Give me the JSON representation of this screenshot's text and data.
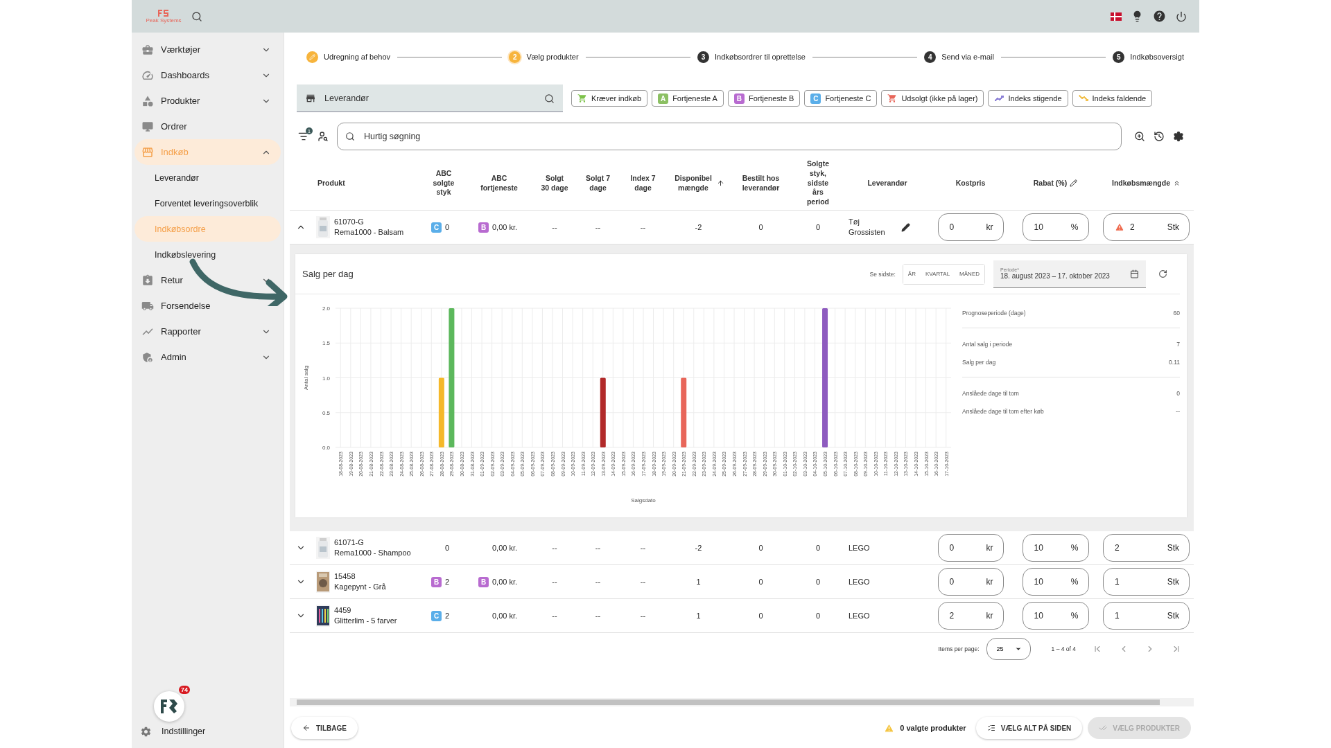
{
  "topbar": {
    "logo_text": "Peak Systems"
  },
  "sidebar": {
    "items": [
      {
        "kind": "group",
        "label": "Værktøjer",
        "expanded": false,
        "selected": false
      },
      {
        "kind": "group",
        "label": "Dashboards",
        "expanded": false,
        "selected": false
      },
      {
        "kind": "group",
        "label": "Produkter",
        "expanded": false,
        "selected": false
      },
      {
        "kind": "link",
        "label": "Ordrer",
        "selected": false
      },
      {
        "kind": "group",
        "label": "Indkøb",
        "expanded": true,
        "selected": true,
        "children": [
          {
            "label": "Leverandør",
            "selected": false
          },
          {
            "label": "Forventet leveringsoverblik",
            "selected": false
          },
          {
            "label": "Indkøbsordre",
            "selected": true
          },
          {
            "label": "Indkøbslevering",
            "selected": false
          }
        ]
      },
      {
        "kind": "group",
        "label": "Retur",
        "expanded": false,
        "selected": false
      },
      {
        "kind": "link",
        "label": "Forsendelse",
        "selected": false
      },
      {
        "kind": "group",
        "label": "Rapporter",
        "expanded": false,
        "selected": false
      },
      {
        "kind": "group",
        "label": "Admin",
        "expanded": false,
        "selected": false
      }
    ],
    "notification_count": "74",
    "settings_label": "Indstillinger"
  },
  "stepper": [
    {
      "label": "Udregning af behov",
      "completed": true,
      "selected": false
    },
    {
      "number": "2",
      "label": "Vælg produkter",
      "completed": false,
      "selected": true
    },
    {
      "number": "3",
      "label": "Indkøbsordrer til oprettelse",
      "completed": false,
      "selected": false
    },
    {
      "number": "4",
      "label": "Send via e-mail",
      "completed": false,
      "selected": false
    },
    {
      "number": "5",
      "label": "Indkøbsoversigt",
      "completed": false,
      "selected": false
    }
  ],
  "supplier_field": {
    "placeholder": "Leverandør"
  },
  "filter_chips": [
    {
      "kind": "cart",
      "label": "Kræver indkøb",
      "color": "#7dc24a"
    },
    {
      "kind": "grade",
      "grade": "A",
      "label": "Fortjeneste A",
      "color": "#8cc063"
    },
    {
      "kind": "grade",
      "grade": "B",
      "label": "Fortjeneste B",
      "color": "#b86bd0"
    },
    {
      "kind": "grade",
      "grade": "C",
      "label": "Fortjeneste C",
      "color": "#5aaee9"
    },
    {
      "kind": "cart",
      "label": "Udsolgt (ikke på lager)",
      "color": "#e8665a"
    },
    {
      "kind": "trend-up",
      "label": "Indeks stigende",
      "color": "#8b7fd6"
    },
    {
      "kind": "trend-down",
      "label": "Indeks faldende",
      "color": "#f2c14e"
    }
  ],
  "filter_badge": "1",
  "quick_search": {
    "placeholder": "Hurtig søgning"
  },
  "table": {
    "columns": [
      {
        "label": "Produkt"
      },
      {
        "label": "ABC solgte styk"
      },
      {
        "label": "ABC fortjeneste"
      },
      {
        "label": "Solgt 30 dage"
      },
      {
        "label": "Solgt 7 dage"
      },
      {
        "label": "Index 7 dage"
      },
      {
        "label": "Disponibel mængde"
      },
      {
        "label": "Bestilt hos leverandør"
      },
      {
        "label": "Solgte styk, sidste års period"
      },
      {
        "label": "Leverandør"
      },
      {
        "label": "Kostpris"
      },
      {
        "label": "Rabat (%)"
      },
      {
        "label": "Indkøbsmængde"
      }
    ],
    "rows": [
      {
        "expanded": true,
        "sku": "61070-G",
        "name": "Rema1000 - Balsam",
        "abc_sold": {
          "grade": "C",
          "color": "#5aaee9",
          "value": "0"
        },
        "abc_profit": {
          "grade": "B",
          "color": "#b86bd0",
          "value": "0,00 kr."
        },
        "sold_30": "--",
        "sold_7": "--",
        "index_7": "--",
        "available": "-2",
        "ordered": "0",
        "sold_last_year": "0",
        "supplier": "Tøj Grossisten",
        "supplier_editable": true,
        "cost": {
          "value": "0",
          "unit": "kr"
        },
        "discount": {
          "value": "10",
          "unit": "%"
        },
        "quantity": {
          "value": "2",
          "unit": "Stk",
          "warning": true
        },
        "detail": {
          "title": "Salg per dag",
          "range_label": "Se sidste:",
          "range_buttons": [
            "ÅR",
            "KVARTAL",
            "MÅNED"
          ],
          "period": {
            "label": "Periode*",
            "value": "18. august 2023 – 17. oktober 2023"
          },
          "chart_data": {
            "type": "bar",
            "xlabel": "Salgsdato",
            "ylabel": "Antal salg",
            "grid": true,
            "categories": [
              "18-08-2023",
              "19-08-2023",
              "20-08-2023",
              "21-08-2023",
              "22-08-2023",
              "23-08-2023",
              "24-08-2023",
              "25-08-2023",
              "26-08-2023",
              "27-08-2023",
              "28-08-2023",
              "29-08-2023",
              "30-08-2023",
              "31-08-2023",
              "01-09-2023",
              "02-09-2023",
              "03-09-2023",
              "04-09-2023",
              "05-09-2023",
              "06-09-2023",
              "07-09-2023",
              "08-09-2023",
              "09-09-2023",
              "10-09-2023",
              "11-09-2023",
              "12-09-2023",
              "13-09-2023",
              "14-09-2023",
              "15-09-2023",
              "16-09-2023",
              "17-09-2023",
              "18-09-2023",
              "19-09-2023",
              "20-09-2023",
              "21-09-2023",
              "22-09-2023",
              "23-09-2023",
              "24-09-2023",
              "25-09-2023",
              "26-09-2023",
              "27-09-2023",
              "28-09-2023",
              "29-09-2023",
              "30-09-2023",
              "01-10-2023",
              "02-10-2023",
              "03-10-2023",
              "04-10-2023",
              "05-10-2023",
              "06-10-2023",
              "07-10-2023",
              "08-10-2023",
              "09-10-2023",
              "10-10-2023",
              "11-10-2023",
              "12-10-2023",
              "13-10-2023",
              "14-10-2023",
              "15-10-2023",
              "16-10-2023",
              "17-10-2023"
            ],
            "series": [
              {
                "color": "#f5b82a",
                "values": [
                  null,
                  null,
                  null,
                  null,
                  null,
                  null,
                  null,
                  null,
                  null,
                  null,
                  1,
                  null,
                  null,
                  null,
                  null,
                  null,
                  null,
                  null,
                  null,
                  null,
                  null,
                  null,
                  null,
                  null,
                  null,
                  null,
                  null,
                  null,
                  null,
                  null,
                  null,
                  null,
                  null,
                  null,
                  null,
                  null,
                  null,
                  null,
                  null,
                  null,
                  null,
                  null,
                  null,
                  null,
                  null,
                  null,
                  null,
                  null,
                  null,
                  null,
                  null,
                  null,
                  null,
                  null,
                  null,
                  null,
                  null,
                  null,
                  null,
                  null,
                  null
                ]
              },
              {
                "color": "#5cb85c",
                "values": [
                  null,
                  null,
                  null,
                  null,
                  null,
                  null,
                  null,
                  null,
                  null,
                  null,
                  null,
                  2,
                  null,
                  null,
                  null,
                  null,
                  null,
                  null,
                  null,
                  null,
                  null,
                  null,
                  null,
                  null,
                  null,
                  null,
                  null,
                  null,
                  null,
                  null,
                  null,
                  null,
                  null,
                  null,
                  null,
                  null,
                  null,
                  null,
                  null,
                  null,
                  null,
                  null,
                  null,
                  null,
                  null,
                  null,
                  null,
                  null,
                  null,
                  null,
                  null,
                  null,
                  null,
                  null,
                  null,
                  null,
                  null,
                  null,
                  null,
                  null,
                  null
                ]
              },
              {
                "color": "#b22a2a",
                "values": [
                  null,
                  null,
                  null,
                  null,
                  null,
                  null,
                  null,
                  null,
                  null,
                  null,
                  null,
                  null,
                  null,
                  null,
                  null,
                  null,
                  null,
                  null,
                  null,
                  null,
                  null,
                  null,
                  null,
                  null,
                  null,
                  null,
                  1,
                  null,
                  null,
                  null,
                  null,
                  null,
                  null,
                  null,
                  null,
                  null,
                  null,
                  null,
                  null,
                  null,
                  null,
                  null,
                  null,
                  null,
                  null,
                  null,
                  null,
                  null,
                  null,
                  null,
                  null,
                  null,
                  null,
                  null,
                  null,
                  null,
                  null,
                  null,
                  null,
                  null,
                  null
                ]
              },
              {
                "color": "#e8665a",
                "values": [
                  null,
                  null,
                  null,
                  null,
                  null,
                  null,
                  null,
                  null,
                  null,
                  null,
                  null,
                  null,
                  null,
                  null,
                  null,
                  null,
                  null,
                  null,
                  null,
                  null,
                  null,
                  null,
                  null,
                  null,
                  null,
                  null,
                  null,
                  null,
                  null,
                  null,
                  null,
                  null,
                  null,
                  null,
                  1,
                  null,
                  null,
                  null,
                  null,
                  null,
                  null,
                  null,
                  null,
                  null,
                  null,
                  null,
                  null,
                  null,
                  null,
                  null,
                  null,
                  null,
                  null,
                  null,
                  null,
                  null,
                  null,
                  null,
                  null,
                  null,
                  null
                ]
              },
              {
                "color": "#8e5bbf",
                "values": [
                  null,
                  null,
                  null,
                  null,
                  null,
                  null,
                  null,
                  null,
                  null,
                  null,
                  null,
                  null,
                  null,
                  null,
                  null,
                  null,
                  null,
                  null,
                  null,
                  null,
                  null,
                  null,
                  null,
                  null,
                  null,
                  null,
                  null,
                  null,
                  null,
                  null,
                  null,
                  null,
                  null,
                  null,
                  null,
                  null,
                  null,
                  null,
                  null,
                  null,
                  null,
                  null,
                  null,
                  null,
                  null,
                  null,
                  null,
                  null,
                  2,
                  null,
                  null,
                  null,
                  null,
                  null,
                  null,
                  null,
                  null,
                  null,
                  null,
                  null,
                  null
                ]
              }
            ],
            "ylim": [
              0,
              2
            ],
            "yticks": [
              {
                "value": 0,
                "label": "0.0"
              },
              {
                "value": 0.5,
                "label": "0.5"
              },
              {
                "value": 1,
                "label": "1.0"
              },
              {
                "value": 1.5,
                "label": "1.5"
              },
              {
                "value": 2,
                "label": "2.0"
              }
            ]
          },
          "stat_groups": [
            {
              "items": [
                {
                  "label": "Prognoseperiode (dage)",
                  "value": "60"
                }
              ]
            },
            {
              "items": [
                {
                  "label": "Antal salg i periode",
                  "value": "7"
                },
                {
                  "label": "Salg per dag",
                  "value": "0.11"
                }
              ]
            },
            {
              "items": [
                {
                  "label": "Anslåede dage til tom",
                  "value": "0"
                },
                {
                  "label": "Anslåede dage til tom efter køb",
                  "value": "--"
                }
              ]
            }
          ]
        }
      },
      {
        "expanded": false,
        "sku": "61071-G",
        "name": "Rema1000 - Shampoo",
        "abc_sold": {
          "value": "0"
        },
        "abc_profit": {
          "value": "0,00 kr."
        },
        "sold_30": "--",
        "sold_7": "--",
        "index_7": "--",
        "available": "-2",
        "ordered": "0",
        "sold_last_year": "0",
        "supplier": "LEGO",
        "supplier_editable": false,
        "cost": {
          "value": "0",
          "unit": "kr"
        },
        "discount": {
          "value": "10",
          "unit": "%"
        },
        "quantity": {
          "value": "2",
          "unit": "Stk",
          "warning": false
        }
      },
      {
        "expanded": false,
        "sku": "15458",
        "name": "Kagepynt - Grå",
        "abc_sold": {
          "grade": "B",
          "color": "#b86bd0",
          "value": "2"
        },
        "abc_profit": {
          "grade": "B",
          "color": "#b86bd0",
          "value": "0,00 kr."
        },
        "sold_30": "--",
        "sold_7": "--",
        "index_7": "--",
        "available": "1",
        "ordered": "0",
        "sold_last_year": "0",
        "supplier": "LEGO",
        "supplier_editable": false,
        "cost": {
          "value": "0",
          "unit": "kr"
        },
        "discount": {
          "value": "10",
          "unit": "%"
        },
        "quantity": {
          "value": "1",
          "unit": "Stk",
          "warning": false
        }
      },
      {
        "expanded": false,
        "sku": "4459",
        "name": "Glitterlim - 5 farver",
        "abc_sold": {
          "grade": "C",
          "color": "#5aaee9",
          "value": "2"
        },
        "abc_profit": {
          "value": "0,00 kr."
        },
        "sold_30": "--",
        "sold_7": "--",
        "index_7": "--",
        "available": "1",
        "ordered": "0",
        "sold_last_year": "0",
        "supplier": "LEGO",
        "supplier_editable": false,
        "cost": {
          "value": "2",
          "unit": "kr"
        },
        "discount": {
          "value": "10",
          "unit": "%"
        },
        "quantity": {
          "value": "1",
          "unit": "Stk",
          "warning": false
        }
      }
    ]
  },
  "pagination": {
    "label": "Items per page:",
    "page_size": "25",
    "range": "1 – 4 of 4"
  },
  "footer": {
    "back": "TILBAGE",
    "selected_count": "0 valgte produkter",
    "select_all": "VÆLG ALT PÅ SIDEN",
    "confirm": {
      "label": "VÆLG PRODUKTER",
      "disabled": true
    }
  }
}
